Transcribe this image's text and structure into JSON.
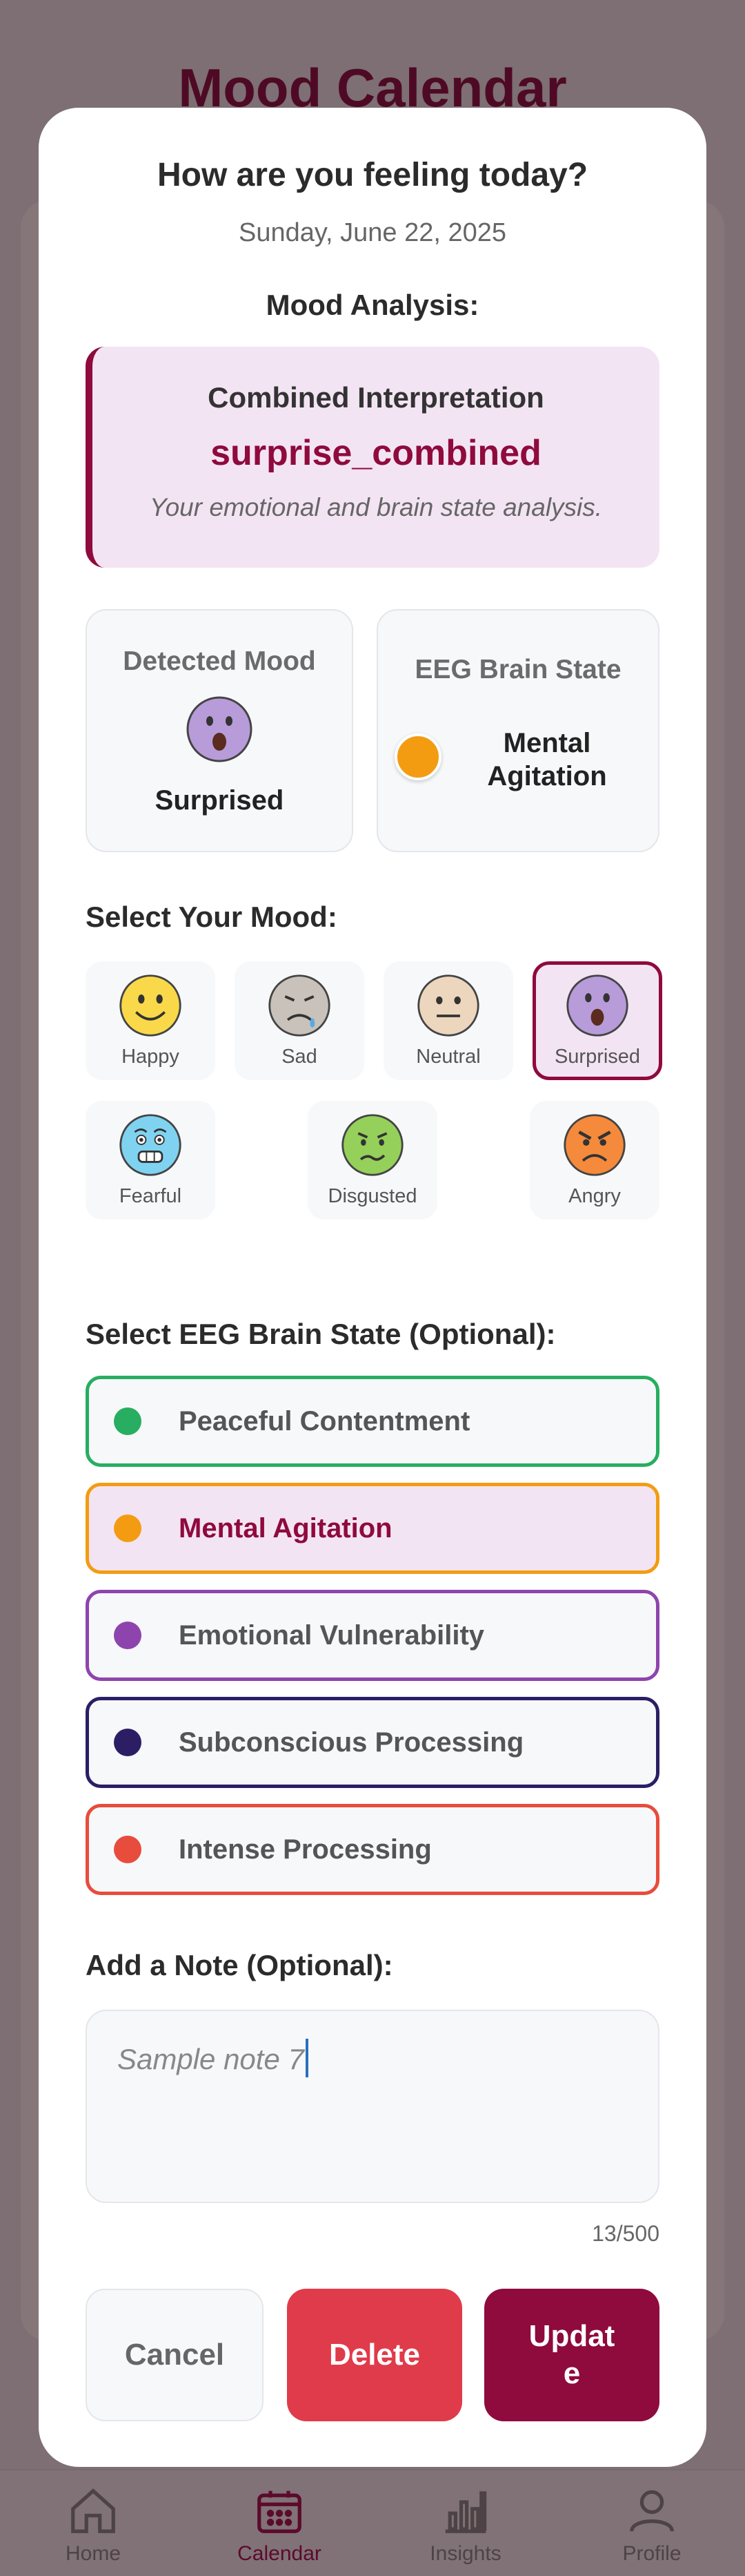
{
  "background": {
    "title": "Mood Calendar",
    "tabs": [
      {
        "label": "Home",
        "icon": "home-icon"
      },
      {
        "label": "Calendar",
        "icon": "calendar-icon",
        "active": true
      },
      {
        "label": "Insights",
        "icon": "bar-chart-icon"
      },
      {
        "label": "Profile",
        "icon": "user-icon"
      }
    ]
  },
  "modal": {
    "title": "How are you feeling today?",
    "date": "Sunday, June 22, 2025",
    "analysis_label": "Mood Analysis:",
    "interpretation": {
      "heading": "Combined Interpretation",
      "value": "surprise_combined",
      "description": "Your emotional and brain state analysis."
    },
    "detected_mood": {
      "heading": "Detected Mood",
      "value": "Surprised",
      "icon": "surprised-face-icon"
    },
    "eeg_state": {
      "heading": "EEG Brain State",
      "value": "Mental Agitation",
      "color": "#f39c12"
    },
    "mood_section_label": "Select Your Mood:",
    "moods": [
      {
        "label": "Happy",
        "icon": "happy-face-icon",
        "selected": false
      },
      {
        "label": "Sad",
        "icon": "sad-face-icon",
        "selected": false
      },
      {
        "label": "Neutral",
        "icon": "neutral-face-icon",
        "selected": false
      },
      {
        "label": "Surprised",
        "icon": "surprised-face-icon",
        "selected": true
      },
      {
        "label": "Fearful",
        "icon": "fearful-face-icon",
        "selected": false
      },
      {
        "label": "Disgusted",
        "icon": "disgusted-face-icon",
        "selected": false
      },
      {
        "label": "Angry",
        "icon": "angry-face-icon",
        "selected": false
      }
    ],
    "eeg_section_label": "Select EEG Brain State (Optional):",
    "eeg_options": [
      {
        "label": "Peaceful Contentment",
        "color": "#27ae60",
        "selected": false
      },
      {
        "label": "Mental Agitation",
        "color": "#f39c12",
        "selected": true
      },
      {
        "label": "Emotional Vulnerability",
        "color": "#8e44ad",
        "selected": false
      },
      {
        "label": "Subconscious Processing",
        "color": "#2c1e64",
        "selected": false
      },
      {
        "label": "Intense Processing",
        "color": "#e74c3c",
        "selected": false
      }
    ],
    "note_label": "Add a Note (Optional):",
    "note_value": "Sample note 7",
    "note_counter": "13/500",
    "buttons": {
      "cancel": "Cancel",
      "delete": "Delete",
      "update_line1": "Updat",
      "update_line2": "e"
    }
  },
  "colors": {
    "accent": "#8f0a3d",
    "danger": "#e03b4a",
    "selected_bg": "#f3e4f4"
  }
}
